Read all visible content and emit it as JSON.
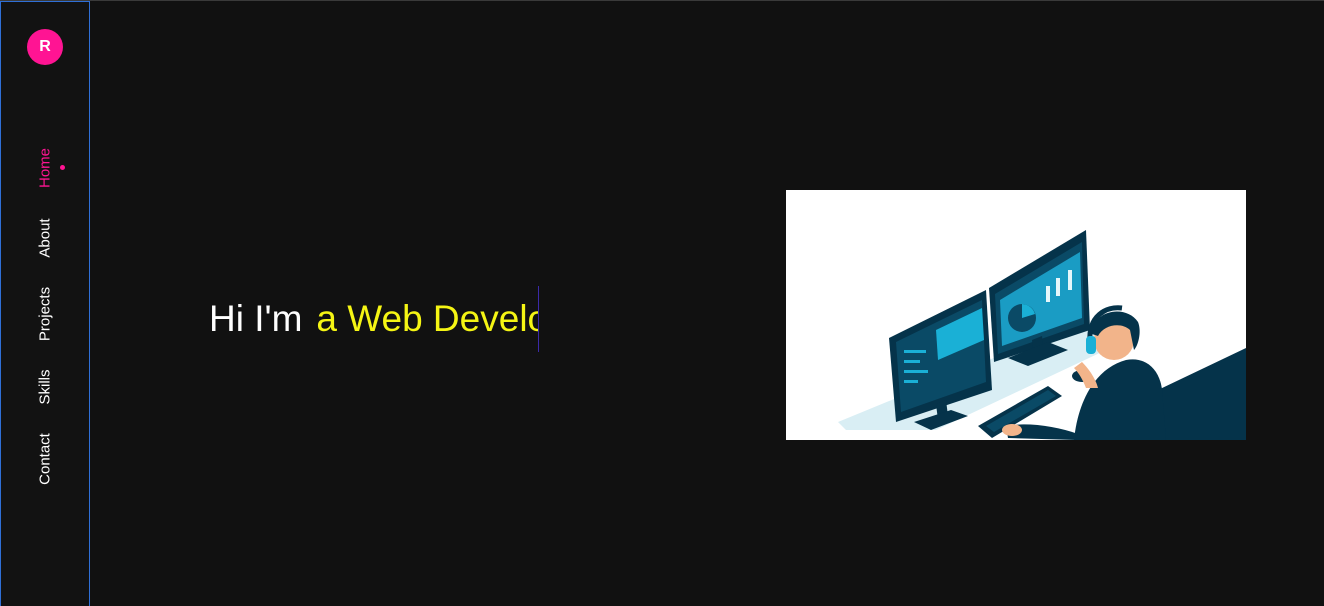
{
  "brand": {
    "logo_letter": "R",
    "accent_color": "#ff1493"
  },
  "nav": {
    "items": [
      {
        "label": "Home",
        "active": true
      },
      {
        "label": "About",
        "active": false
      },
      {
        "label": "Projects",
        "active": false
      },
      {
        "label": "Skills",
        "active": false
      },
      {
        "label": "Contact",
        "active": false
      }
    ]
  },
  "hero": {
    "greeting": "Hi I'm",
    "typed_text": "a Web Develo",
    "typed_color": "#f5f514"
  },
  "illustration": {
    "icon": "developer-at-computer-illustration"
  }
}
